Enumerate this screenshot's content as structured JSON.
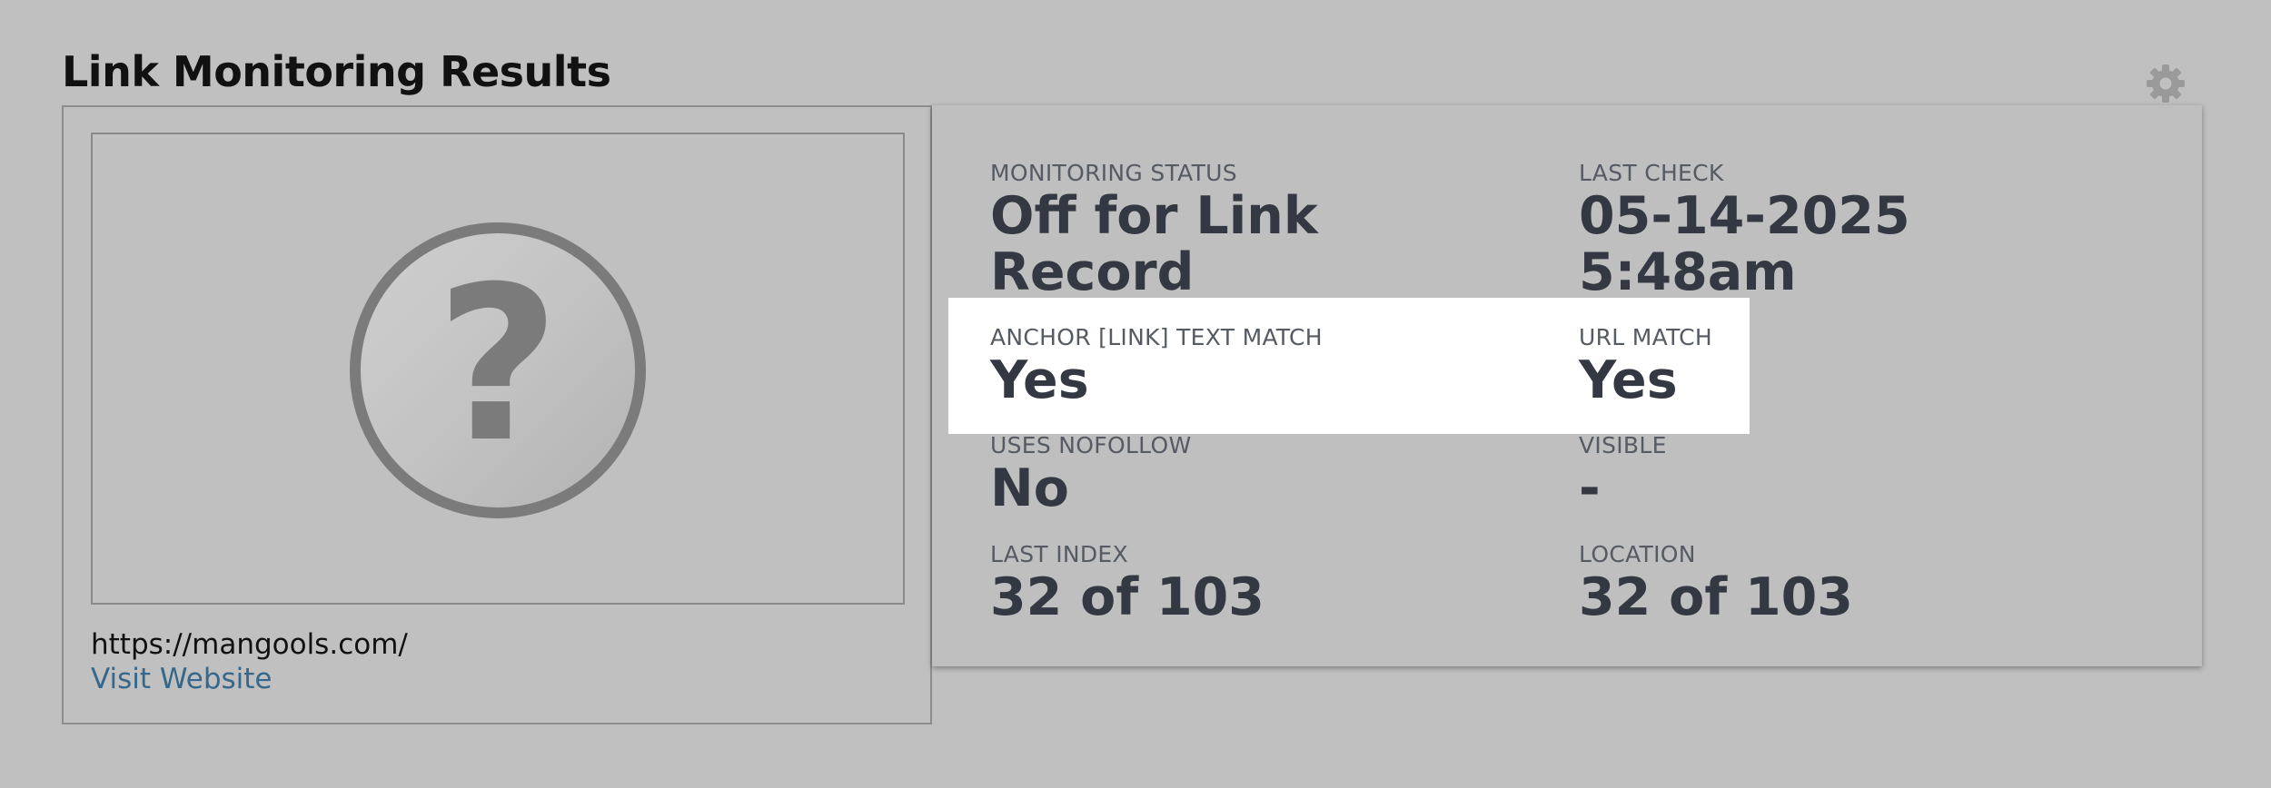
{
  "page": {
    "title": "Link Monitoring Results"
  },
  "icons": {
    "settings": "gear-icon",
    "thumbnail_placeholder": "question-mark-icon"
  },
  "preview": {
    "url": "https://mangools.com/",
    "visit_label": "Visit Website"
  },
  "stats": {
    "monitoring_status": {
      "label": "MONITORING STATUS",
      "value_line1": "Off for Link",
      "value_line2": "Record"
    },
    "last_check": {
      "label": "LAST CHECK",
      "value_line1": "05-14-2025",
      "value_line2": "5:48am"
    },
    "anchor_text_match": {
      "label": "ANCHOR [LINK] TEXT MATCH",
      "value": "Yes"
    },
    "url_match": {
      "label": "URL MATCH",
      "value": "Yes"
    },
    "uses_nofollow": {
      "label": "USES NOFOLLOW",
      "value": "No"
    },
    "visible": {
      "label": "VISIBLE",
      "value": "-"
    },
    "last_index": {
      "label": "LAST INDEX",
      "value": "32 of 103"
    },
    "location": {
      "label": "LOCATION",
      "value": "32 of 103"
    }
  },
  "colors": {
    "background": "#c0c0c0",
    "highlight": "#ffffff",
    "link": "#36678c",
    "value_text": "#343842",
    "label_text": "#555a63"
  }
}
